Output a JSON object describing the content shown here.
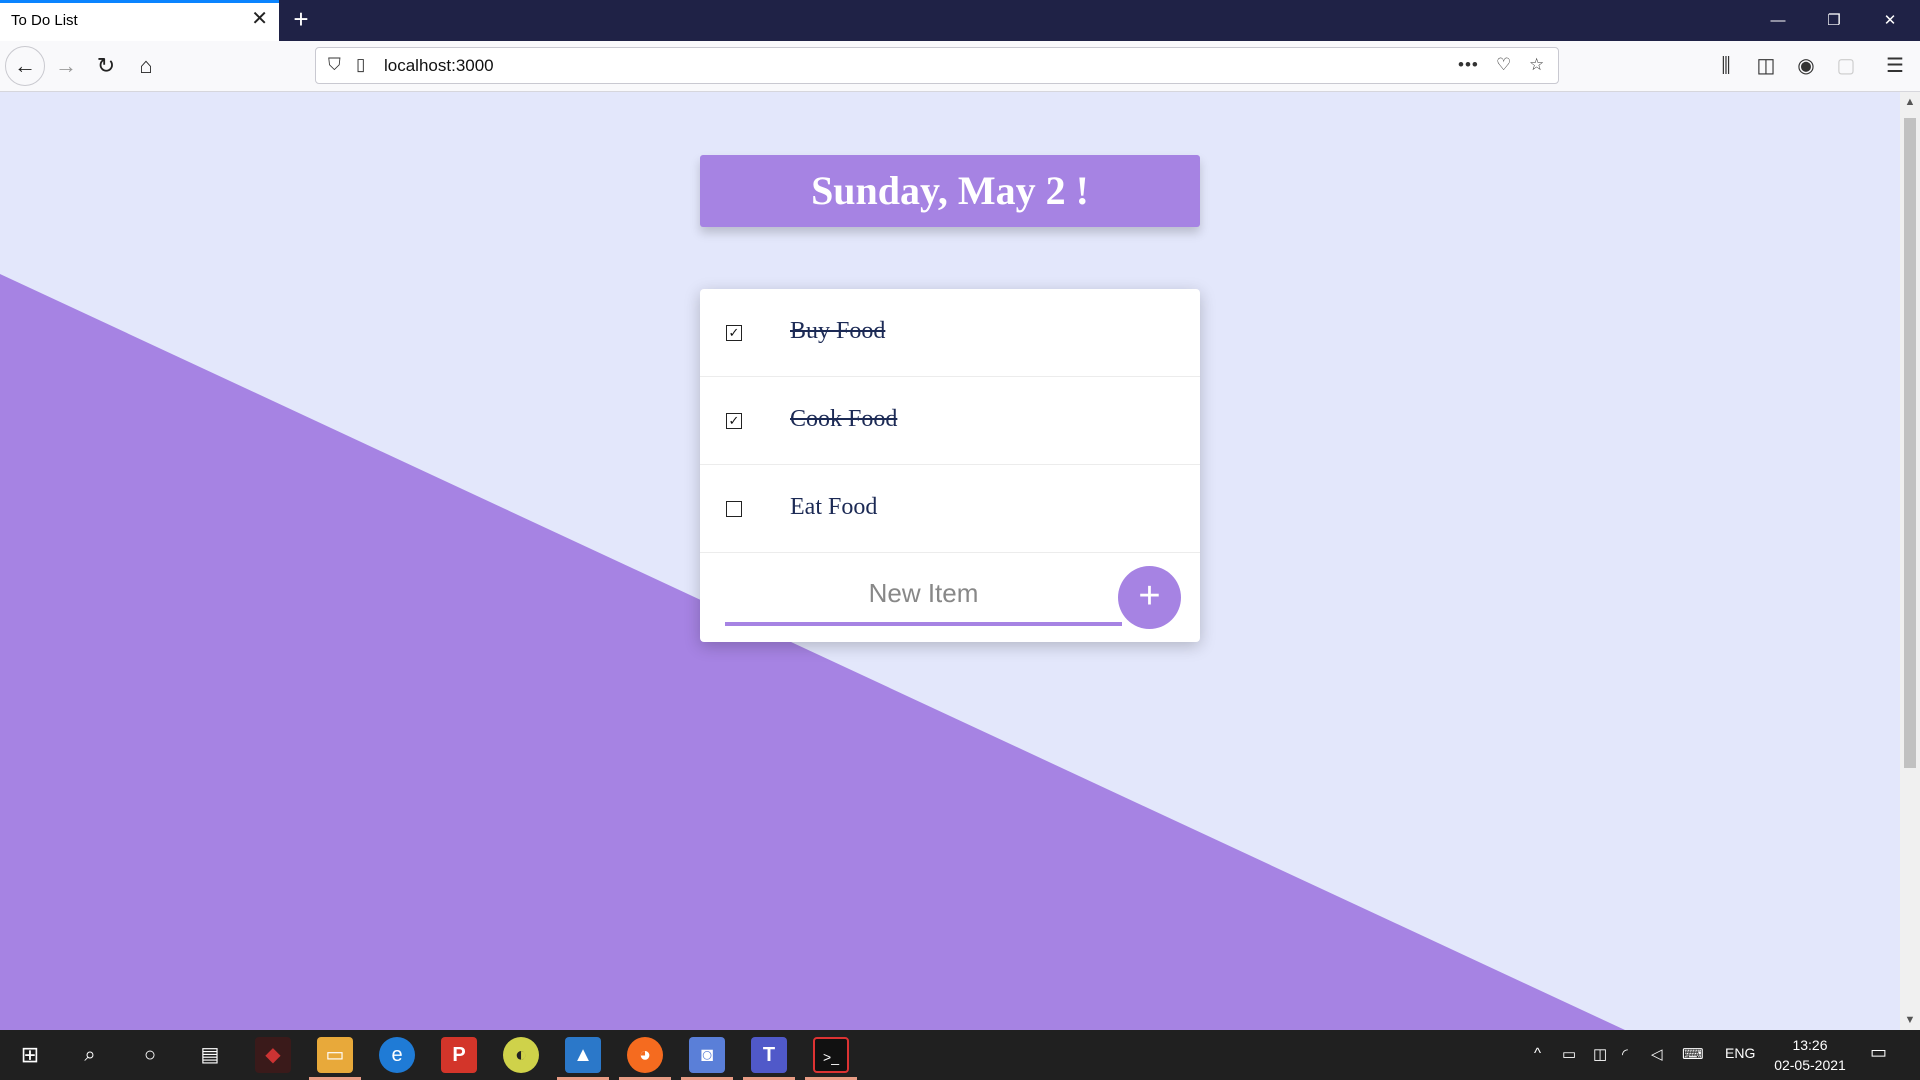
{
  "browser": {
    "tab_title": "To Do List",
    "url": "localhost:3000"
  },
  "page": {
    "heading": "Sunday, May 2 !",
    "items": [
      {
        "label": "Buy Food",
        "checked": true
      },
      {
        "label": "Cook Food",
        "checked": true
      },
      {
        "label": "Eat Food",
        "checked": false
      }
    ],
    "new_item": {
      "value": "",
      "placeholder": "New Item"
    },
    "add_label": "+",
    "colors": {
      "accent": "#a683e3",
      "background": "#e3e7fb",
      "text": "#1c2a55"
    }
  },
  "taskbar": {
    "language": "ENG",
    "time": "13:26",
    "date": "02-05-2021"
  }
}
